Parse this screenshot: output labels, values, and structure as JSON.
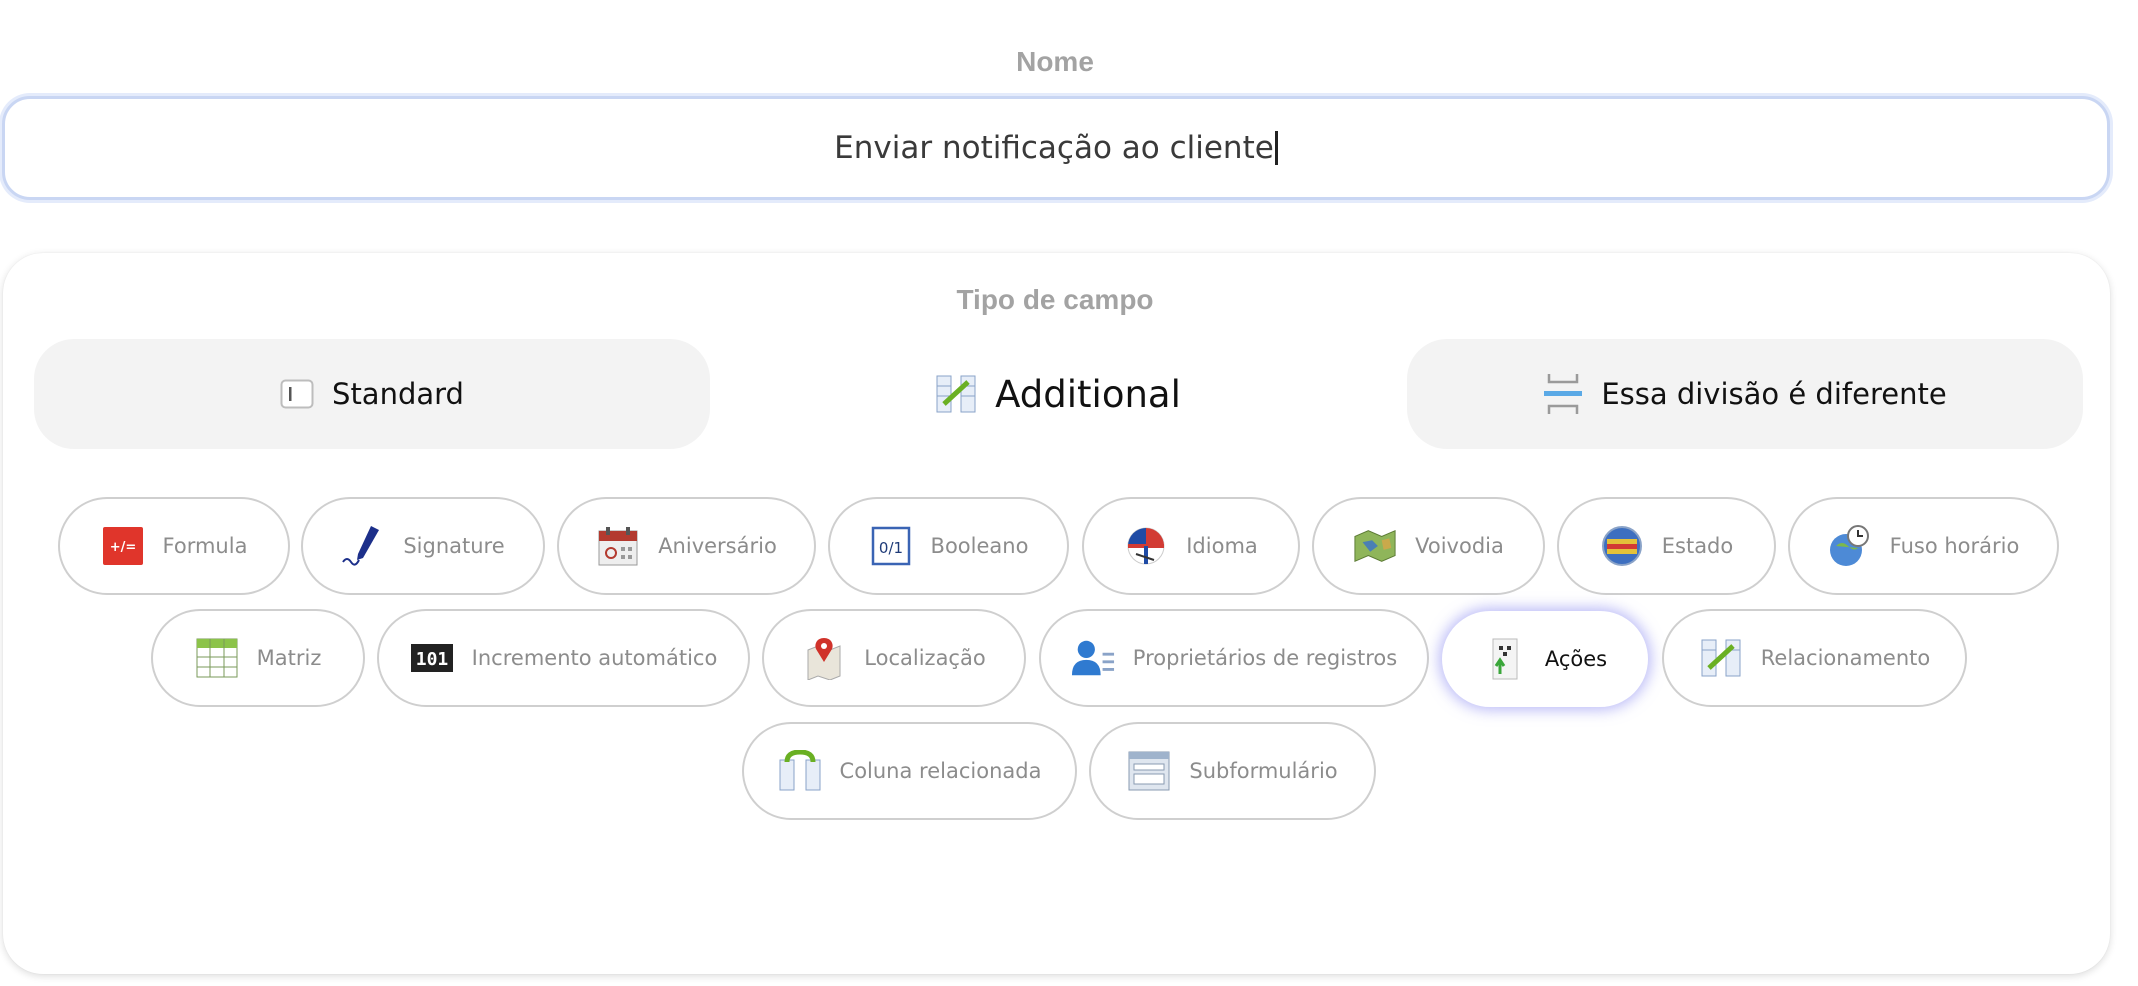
{
  "name_section": {
    "label": "Nome",
    "value": "Enviar notificação ao cliente"
  },
  "field_type": {
    "label": "Tipo de campo",
    "tabs": [
      {
        "label": "Standard",
        "icon": "input-field-icon",
        "active": false
      },
      {
        "label": "Additional",
        "icon": "relationship-icon",
        "active": true
      },
      {
        "label": "Essa divisão é diferente",
        "icon": "divider-icon",
        "active": false
      }
    ],
    "chips": [
      {
        "label": "Formula",
        "icon": "formula-icon"
      },
      {
        "label": "Signature",
        "icon": "pen-icon"
      },
      {
        "label": "Aniversário",
        "icon": "calendar-icon"
      },
      {
        "label": "Booleano",
        "icon": "boolean-icon"
      },
      {
        "label": "Idioma",
        "icon": "language-flags-icon"
      },
      {
        "label": "Voivodia",
        "icon": "map-icon"
      },
      {
        "label": "Estado",
        "icon": "globe-flag-icon"
      },
      {
        "label": "Fuso horário",
        "icon": "timezone-globe-icon"
      },
      {
        "label": "Matriz",
        "icon": "table-icon"
      },
      {
        "label": "Incremento automático",
        "icon": "counter-icon"
      },
      {
        "label": "Localização",
        "icon": "map-pin-icon"
      },
      {
        "label": "Proprietários de registros",
        "icon": "user-icon"
      },
      {
        "label": "Ações",
        "icon": "actions-icon",
        "selected": true
      },
      {
        "label": "Relacionamento",
        "icon": "relationship-icon"
      },
      {
        "label": "Coluna relacionada",
        "icon": "related-column-icon"
      },
      {
        "label": "Subformulário",
        "icon": "subform-icon"
      }
    ]
  },
  "colors": {
    "label_gray": "#a3a3a3",
    "chip_border": "#cfcfcf",
    "input_focus": "#c9d6f3",
    "selected_glow": "#8282f0",
    "segment_bg": "#f3f3f3"
  }
}
